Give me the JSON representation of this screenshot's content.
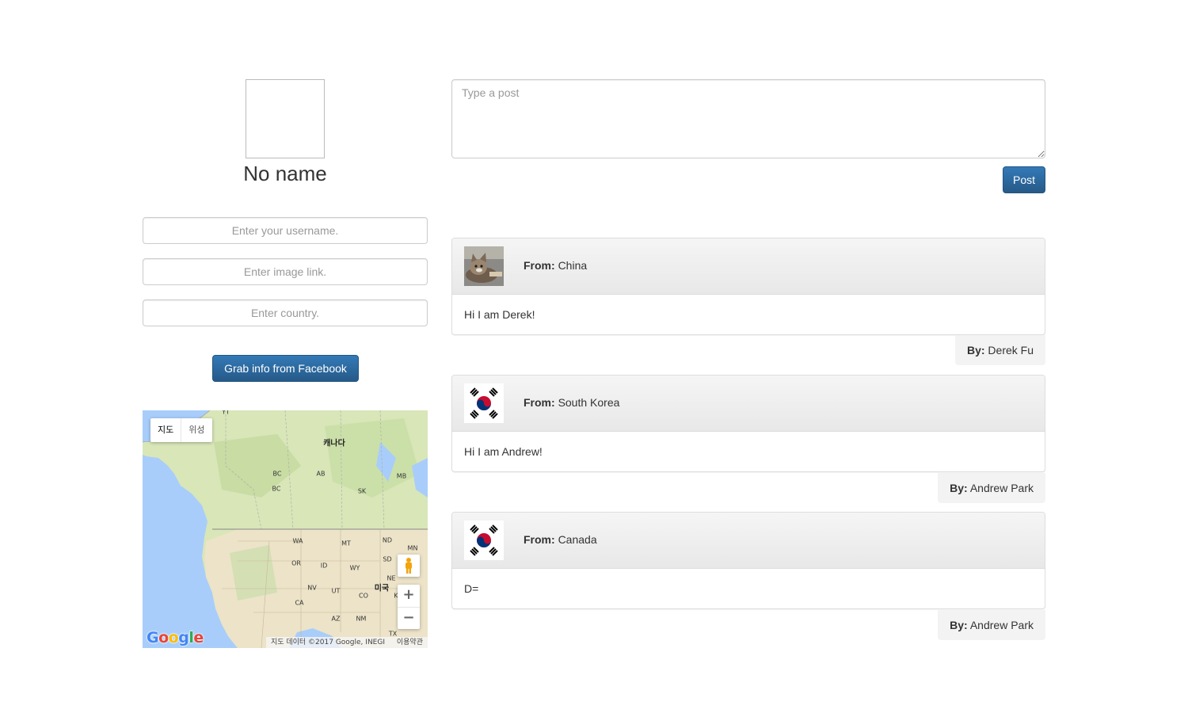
{
  "profile": {
    "name": "No name",
    "username_placeholder": "Enter your username.",
    "image_placeholder": "Enter image link.",
    "country_placeholder": "Enter country.",
    "facebook_button": "Grab info from Facebook"
  },
  "map": {
    "type_map": "지도",
    "type_satellite": "위성",
    "labels": {
      "canada": "캐나다",
      "usa": "미국",
      "yt": "YT",
      "bc": "BC",
      "ab": "AB",
      "sk": "SK",
      "mb": "MB",
      "wa": "WA",
      "mt": "MT",
      "nd": "ND",
      "mn": "MN",
      "or": "OR",
      "id": "ID",
      "wy": "WY",
      "sd": "SD",
      "ne": "NE",
      "nv": "NV",
      "ut": "UT",
      "co": "CO",
      "ks": "K",
      "ca": "CA",
      "az": "AZ",
      "nm": "NM",
      "tx": "TX"
    },
    "zoom_in": "+",
    "zoom_out": "−",
    "logo": "Google",
    "attribution": "지도 데이터 ©2017 Google, INEGI",
    "terms": "이용약관",
    "pegman_icon": "pegman-icon",
    "colors": {
      "water": "#a8cdfa",
      "land": "#d8e6b8",
      "land_south": "#ece3c8"
    }
  },
  "composer": {
    "placeholder": "Type a post",
    "post_button": "Post"
  },
  "posts": [
    {
      "from_label": "From:",
      "from": "China",
      "body": "Hi I am Derek!",
      "by_label": "By:",
      "by": "Derek Fu",
      "thumb": "cat-photo"
    },
    {
      "from_label": "From:",
      "from": "South Korea",
      "body": "Hi I am Andrew!",
      "by_label": "By:",
      "by": "Andrew Park",
      "thumb": "south-korea-flag"
    },
    {
      "from_label": "From:",
      "from": "Canada",
      "body": "D=",
      "by_label": "By:",
      "by": "Andrew Park",
      "thumb": "south-korea-flag"
    }
  ],
  "colors": {
    "primary": "#337ab7",
    "border": "#dddddd",
    "heading": "#f5f5f5"
  }
}
